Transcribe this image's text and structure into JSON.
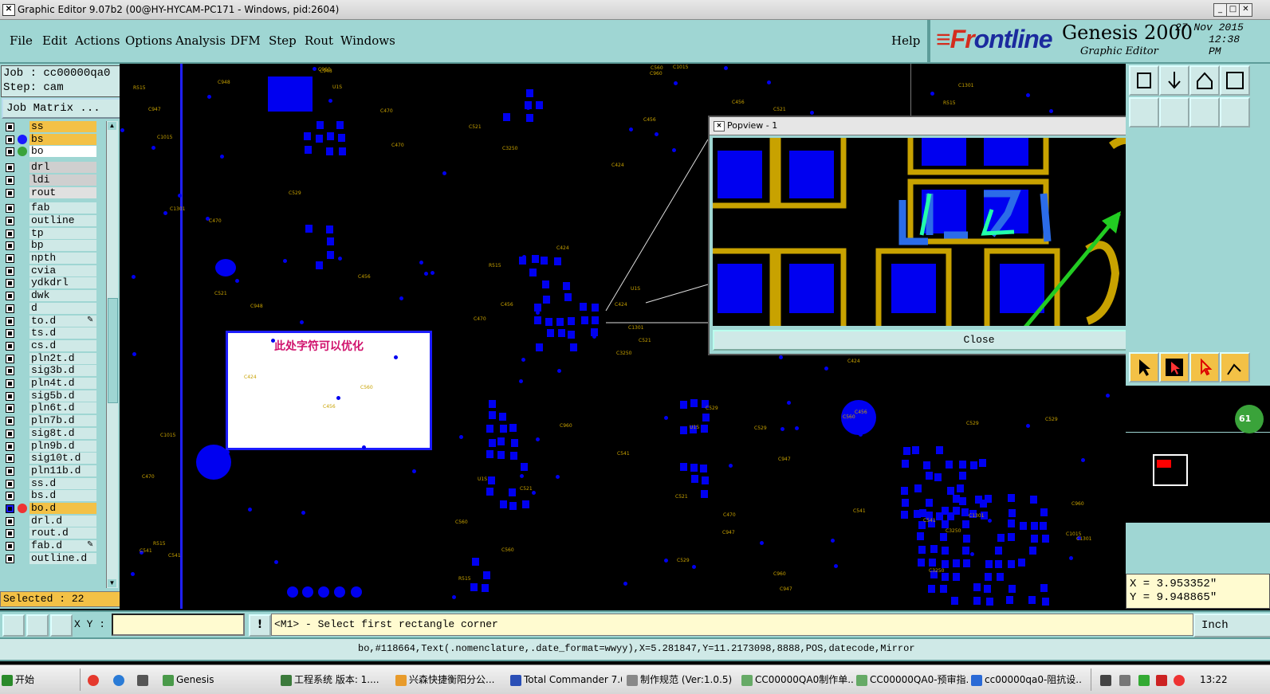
{
  "window": {
    "title": "Graphic Editor 9.07b2 (00@HY-HYCAM-PC171 - Windows, pid:2604)"
  },
  "menu": [
    "File",
    "Edit",
    "Actions",
    "Options",
    "Analysis",
    "DFM",
    "Step",
    "Rout",
    "Windows"
  ],
  "help_label": "Help",
  "brand": {
    "logo_prefix": "≡Fr",
    "logo_o": "o",
    "logo_suffix": "ntline",
    "product": "Genesis 2000",
    "subtitle": "Graphic Editor",
    "date": "27 Nov 2015",
    "time": "12:38 PM"
  },
  "job": {
    "job_line": "Job : cc00000qa0",
    "step_line": "Step: cam",
    "matrix_button": "Job Matrix ..."
  },
  "layers": [
    {
      "name": "ss",
      "color": "#f3c146"
    },
    {
      "name": "bs",
      "color": "#f3c146",
      "dot": "#1a1aff"
    },
    {
      "name": "bo",
      "color": "#ffffff",
      "dot": "#3aa33a"
    },
    {
      "name": "drl",
      "color": "#cfcfcf"
    },
    {
      "name": "ldi",
      "color": "#cfcfcf"
    },
    {
      "name": "rout",
      "color": "#e0e0e0"
    },
    {
      "name": "fab",
      "color": "#cfe9e7"
    },
    {
      "name": "outline",
      "color": "#cfe9e7"
    },
    {
      "name": "tp",
      "color": "#cfe9e7"
    },
    {
      "name": "bp",
      "color": "#cfe9e7"
    },
    {
      "name": "npth",
      "color": "#cfe9e7"
    },
    {
      "name": "cvia",
      "color": "#cfe9e7"
    },
    {
      "name": "ydkdrl",
      "color": "#cfe9e7"
    },
    {
      "name": "dwk",
      "color": "#cfe9e7"
    },
    {
      "name": "d",
      "color": "#cfe9e7"
    },
    {
      "name": "to.d",
      "color": "#cfe9e7",
      "mark": "pencil"
    },
    {
      "name": "ts.d",
      "color": "#cfe9e7"
    },
    {
      "name": "cs.d",
      "color": "#cfe9e7"
    },
    {
      "name": "pln2t.d",
      "color": "#cfe9e7"
    },
    {
      "name": "sig3b.d",
      "color": "#cfe9e7"
    },
    {
      "name": "pln4t.d",
      "color": "#cfe9e7"
    },
    {
      "name": "sig5b.d",
      "color": "#cfe9e7"
    },
    {
      "name": "pln6t.d",
      "color": "#cfe9e7"
    },
    {
      "name": "pln7b.d",
      "color": "#cfe9e7"
    },
    {
      "name": "sig8t.d",
      "color": "#cfe9e7"
    },
    {
      "name": "pln9b.d",
      "color": "#cfe9e7"
    },
    {
      "name": "sig10t.d",
      "color": "#cfe9e7"
    },
    {
      "name": "pln11b.d",
      "color": "#cfe9e7"
    },
    {
      "name": "ss.d",
      "color": "#cfe9e7"
    },
    {
      "name": "bs.d",
      "color": "#cfe9e7"
    },
    {
      "name": "bo.d",
      "color": "#f3c146",
      "mark": "work"
    },
    {
      "name": "drl.d",
      "color": "#cfe9e7"
    },
    {
      "name": "rout.d",
      "color": "#cfe9e7"
    },
    {
      "name": "fab.d",
      "color": "#cfe9e7",
      "mark": "pencil"
    },
    {
      "name": "outline.d",
      "color": "#cfe9e7"
    }
  ],
  "selected": "Selected : 22",
  "note_text": "此处字符可以优化",
  "popview": {
    "title": "Popview - 1",
    "close_label": "Close"
  },
  "status": {
    "xy_label": "X Y :",
    "xy_value": "",
    "message": "<M1> - Select first rectangle corner",
    "unit": "Inch"
  },
  "coords": {
    "x": "X = 3.953352\"",
    "y": "Y = 9.948865\""
  },
  "info": "bo,#118664,Text(.nomenclature,.date_format=wwyy),X=5.281847,Y=11.2173098,8888,POS,datecode,Mirror",
  "taskbar": {
    "start": "开始",
    "items": [
      "Genesis",
      "工程系统 版本: 1....",
      "兴森快捷衡阳分公...",
      "Total Commander 7.0...",
      "制作规范 (Ver:1.0.5)",
      "CC00000QA0制作单...",
      "CC00000QA0-预审指...",
      "cc00000qa0-阻抗设..."
    ],
    "clock": "13:22"
  },
  "badge": "61",
  "colors": {
    "panel": "#9fd6d3",
    "pad": "#0000f0",
    "copper": "#c8a200",
    "arrow": "#22cc22"
  }
}
